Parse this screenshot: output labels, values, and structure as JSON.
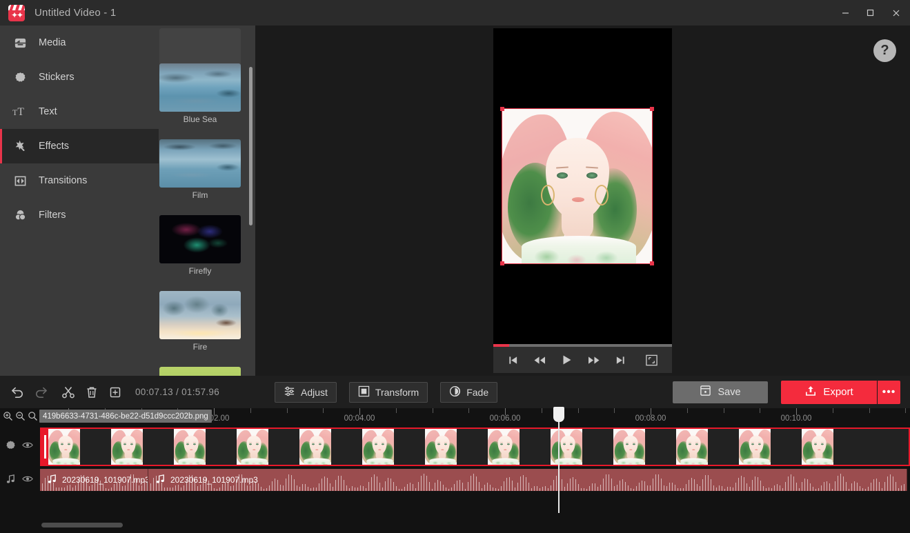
{
  "window": {
    "title": "Untitled Video - 1",
    "logo_icon": "clapperboard-sparkle-icon",
    "minimize_icon": "minimize-icon",
    "maximize_icon": "maximize-icon",
    "close_icon": "close-icon"
  },
  "sidebar": {
    "items": [
      {
        "label": "Media",
        "icon": "media-icon",
        "active": false
      },
      {
        "label": "Stickers",
        "icon": "sticker-icon",
        "active": false
      },
      {
        "label": "Text",
        "icon": "text-icon",
        "active": false
      },
      {
        "label": "Effects",
        "icon": "effects-wand-icon",
        "active": true
      },
      {
        "label": "Transitions",
        "icon": "transitions-icon",
        "active": false
      },
      {
        "label": "Filters",
        "icon": "filters-icon",
        "active": false
      }
    ]
  },
  "browser": {
    "collapse_icon": "chevron-left-icon",
    "items": [
      {
        "label": "",
        "style": "t-blank"
      },
      {
        "label": "Blue Sea",
        "style": "t-bluesea"
      },
      {
        "label": "Film",
        "style": "t-film"
      },
      {
        "label": "Firefly",
        "style": "t-firefly"
      },
      {
        "label": "Fire",
        "style": "t-fire"
      },
      {
        "label": "",
        "style": "t-green"
      }
    ]
  },
  "preview": {
    "help_label": "?",
    "help_icon": "help-icon",
    "progress_percent": 9,
    "controls": [
      {
        "name": "skip-to-start-button",
        "icon": "skip-start-icon"
      },
      {
        "name": "rewind-button",
        "icon": "rewind-icon"
      },
      {
        "name": "play-button",
        "icon": "play-icon"
      },
      {
        "name": "fast-forward-button",
        "icon": "fast-forward-icon"
      },
      {
        "name": "skip-to-end-button",
        "icon": "skip-end-icon"
      },
      {
        "name": "fullscreen-button",
        "icon": "fullscreen-icon"
      }
    ]
  },
  "toolbar": {
    "undo_icon": "undo-icon",
    "redo_icon": "redo-icon",
    "split_icon": "scissors-icon",
    "delete_icon": "trash-icon",
    "crop_icon": "crop-duplicate-icon",
    "timecode": "00:07.13 / 01:57.96",
    "adjust_label": "Adjust",
    "adjust_icon": "sliders-icon",
    "transform_label": "Transform",
    "transform_icon": "transform-square-icon",
    "fade_label": "Fade",
    "fade_icon": "fade-circle-icon",
    "save_label": "Save",
    "save_icon": "save-icon",
    "export_label": "Export",
    "export_icon": "export-upload-icon",
    "export_more_label": "•••"
  },
  "timeline": {
    "zoom_in_icon": "zoom-in-icon",
    "zoom_out_icon": "zoom-out-icon",
    "zoom_fit_icon": "zoom-fit-icon",
    "clip_tooltip": "419b6633-4731-486c-be22-d51d9ccc202b.png",
    "ruler_labels": [
      "00:02.00",
      "00:04.00",
      "00:06.00",
      "00:08.00",
      "00:10.00"
    ],
    "playhead_time": "00:07.13",
    "video_track": {
      "name": "video-track",
      "visibility_icon": "eye-icon",
      "type_icon": "sticker-icon",
      "frame_count": 13
    },
    "audio_track": {
      "name": "audio-track",
      "visibility_icon": "eye-icon",
      "type_icon": "music-note-icon",
      "clips": [
        {
          "label": "20230619_101907.mp3",
          "icon": "music-note-icon"
        },
        {
          "label": "20230619_101907.mp3",
          "icon": "music-note-icon"
        }
      ]
    }
  },
  "colors": {
    "accent_red": "#e8344a",
    "export_red": "#f42b3d",
    "track_red": "#e8182a",
    "audio_clip": "#9b4d4f",
    "panel_bg": "#3a3a3a",
    "titlebar_bg": "#2b2b2b"
  }
}
